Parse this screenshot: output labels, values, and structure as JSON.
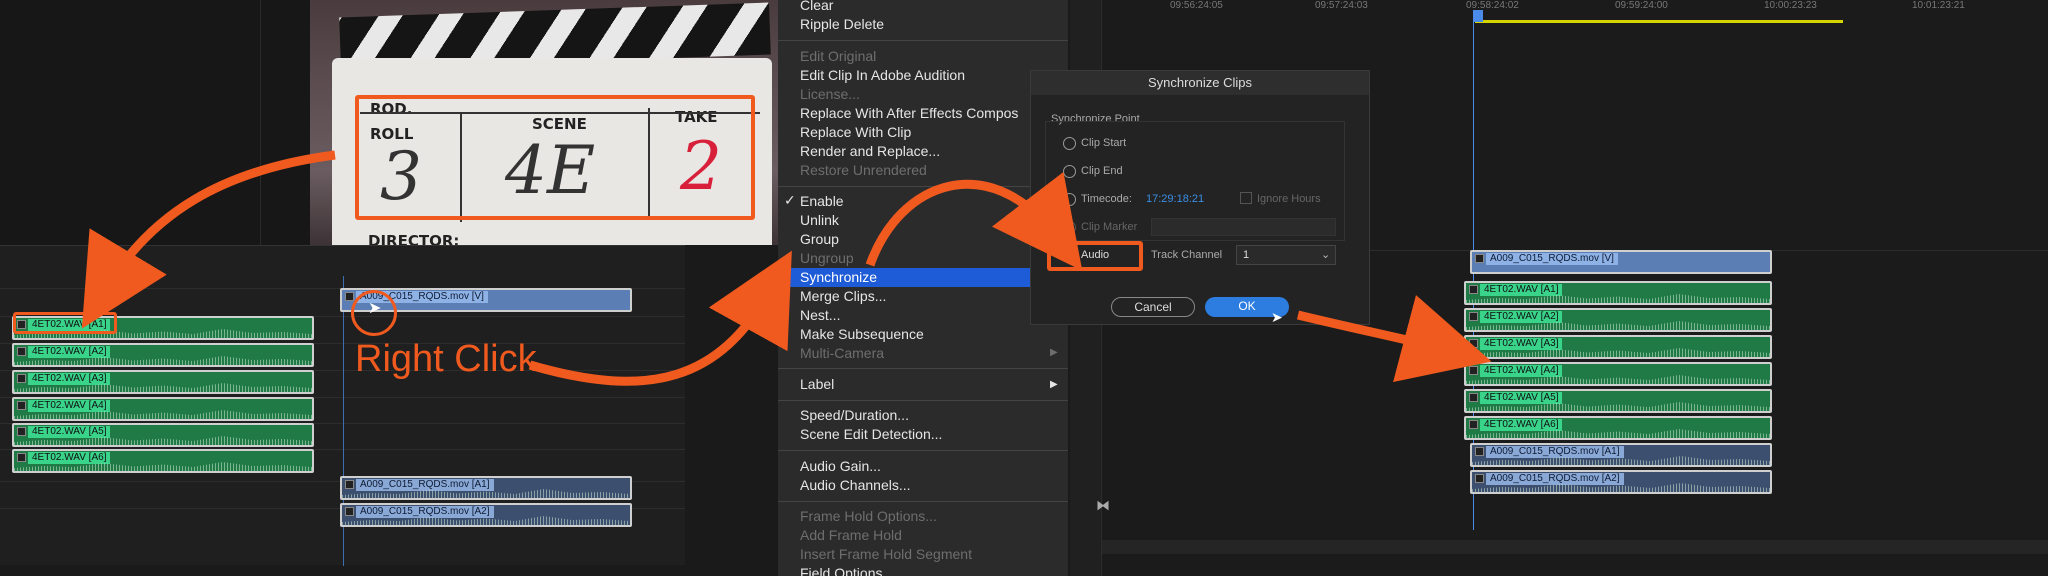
{
  "slate": {
    "prod_label": "ROD.",
    "roll_label": "ROLL",
    "scene_label": "SCENE",
    "take_label": "TAKE",
    "roll_value": "3",
    "scene_value": "4E",
    "take_value": "2",
    "director_label": "DIRECTOR:"
  },
  "annotation": {
    "right_click": "Right Click"
  },
  "left_timeline": {
    "audio_clips": [
      "4ET02.WAV [A1]",
      "4ET02.WAV [A2]",
      "4ET02.WAV [A3]",
      "4ET02.WAV [A4]",
      "4ET02.WAV [A5]",
      "4ET02.WAV [A6]"
    ],
    "video_clip": "A009_C015_RQDS.mov [V]",
    "camera_audio_clips": [
      "A009_C015_RQDS.mov [A1]",
      "A009_C015_RQDS.mov [A2]"
    ]
  },
  "context_menu": {
    "items": [
      {
        "label": "Clear",
        "enabled": true
      },
      {
        "label": "Ripple Delete",
        "enabled": true
      },
      {
        "label": "Edit Original",
        "enabled": false
      },
      {
        "label": "Edit Clip In Adobe Audition",
        "enabled": true
      },
      {
        "label": "License...",
        "enabled": false
      },
      {
        "label": "Replace With After Effects Compos",
        "enabled": true
      },
      {
        "label": "Replace With Clip",
        "enabled": true
      },
      {
        "label": "Render and Replace...",
        "enabled": true
      },
      {
        "label": "Restore Unrendered",
        "enabled": false
      },
      {
        "label": "Enable",
        "enabled": true,
        "checked": true
      },
      {
        "label": "Unlink",
        "enabled": true
      },
      {
        "label": "Group",
        "enabled": true
      },
      {
        "label": "Ungroup",
        "enabled": false
      },
      {
        "label": "Synchronize",
        "enabled": true,
        "highlighted": true
      },
      {
        "label": "Merge Clips...",
        "enabled": true
      },
      {
        "label": "Nest...",
        "enabled": true
      },
      {
        "label": "Make Subsequence",
        "enabled": true
      },
      {
        "label": "Multi-Camera",
        "enabled": false,
        "submenu": true
      },
      {
        "label": "Label",
        "enabled": true,
        "submenu": true
      },
      {
        "label": "Speed/Duration...",
        "enabled": true
      },
      {
        "label": "Scene Edit Detection...",
        "enabled": true
      },
      {
        "label": "Audio Gain...",
        "enabled": true
      },
      {
        "label": "Audio Channels...",
        "enabled": true
      },
      {
        "label": "Frame Hold Options...",
        "enabled": false
      },
      {
        "label": "Add Frame Hold",
        "enabled": false
      },
      {
        "label": "Insert Frame Hold Segment",
        "enabled": false
      },
      {
        "label": "Field Options...",
        "enabled": true
      }
    ],
    "checkmark": "✓",
    "submenu_arrow": "▶"
  },
  "dialog": {
    "title": "Synchronize Clips",
    "group_label": "Synchronize Point",
    "options": {
      "clip_start": "Clip Start",
      "clip_end": "Clip End",
      "timecode": "Timecode:",
      "clip_marker": "Clip Marker",
      "audio": "Audio"
    },
    "timecode_value": "17:29:18:21",
    "ignore_hours": "Ignore Hours",
    "track_channel_label": "Track Channel",
    "track_channel_value": "1",
    "cancel": "Cancel",
    "ok": "OK",
    "accent": "#2d7de0"
  },
  "right_timeline": {
    "ruler": [
      "09:56:24:05",
      "09:57:24:03",
      "09:58:24:02",
      "09:59:24:00",
      "10:00:23:23",
      "10:01:23:21"
    ],
    "video_clip": "A009_C015_RQDS.mov [V]",
    "audio_clips": [
      "4ET02.WAV [A1]",
      "4ET02.WAV [A2]",
      "4ET02.WAV [A3]",
      "4ET02.WAV [A4]",
      "4ET02.WAV [A5]",
      "4ET02.WAV [A6]"
    ],
    "camera_audio_clips": [
      "A009_C015_RQDS.mov [A1]",
      "A009_C015_RQDS.mov [A2]"
    ]
  },
  "colors": {
    "annotation": "#f05a1e",
    "audio_clip": "#1f7a45",
    "video_clip": "#5b7fb5",
    "menu_highlight": "#1e5bd6"
  }
}
